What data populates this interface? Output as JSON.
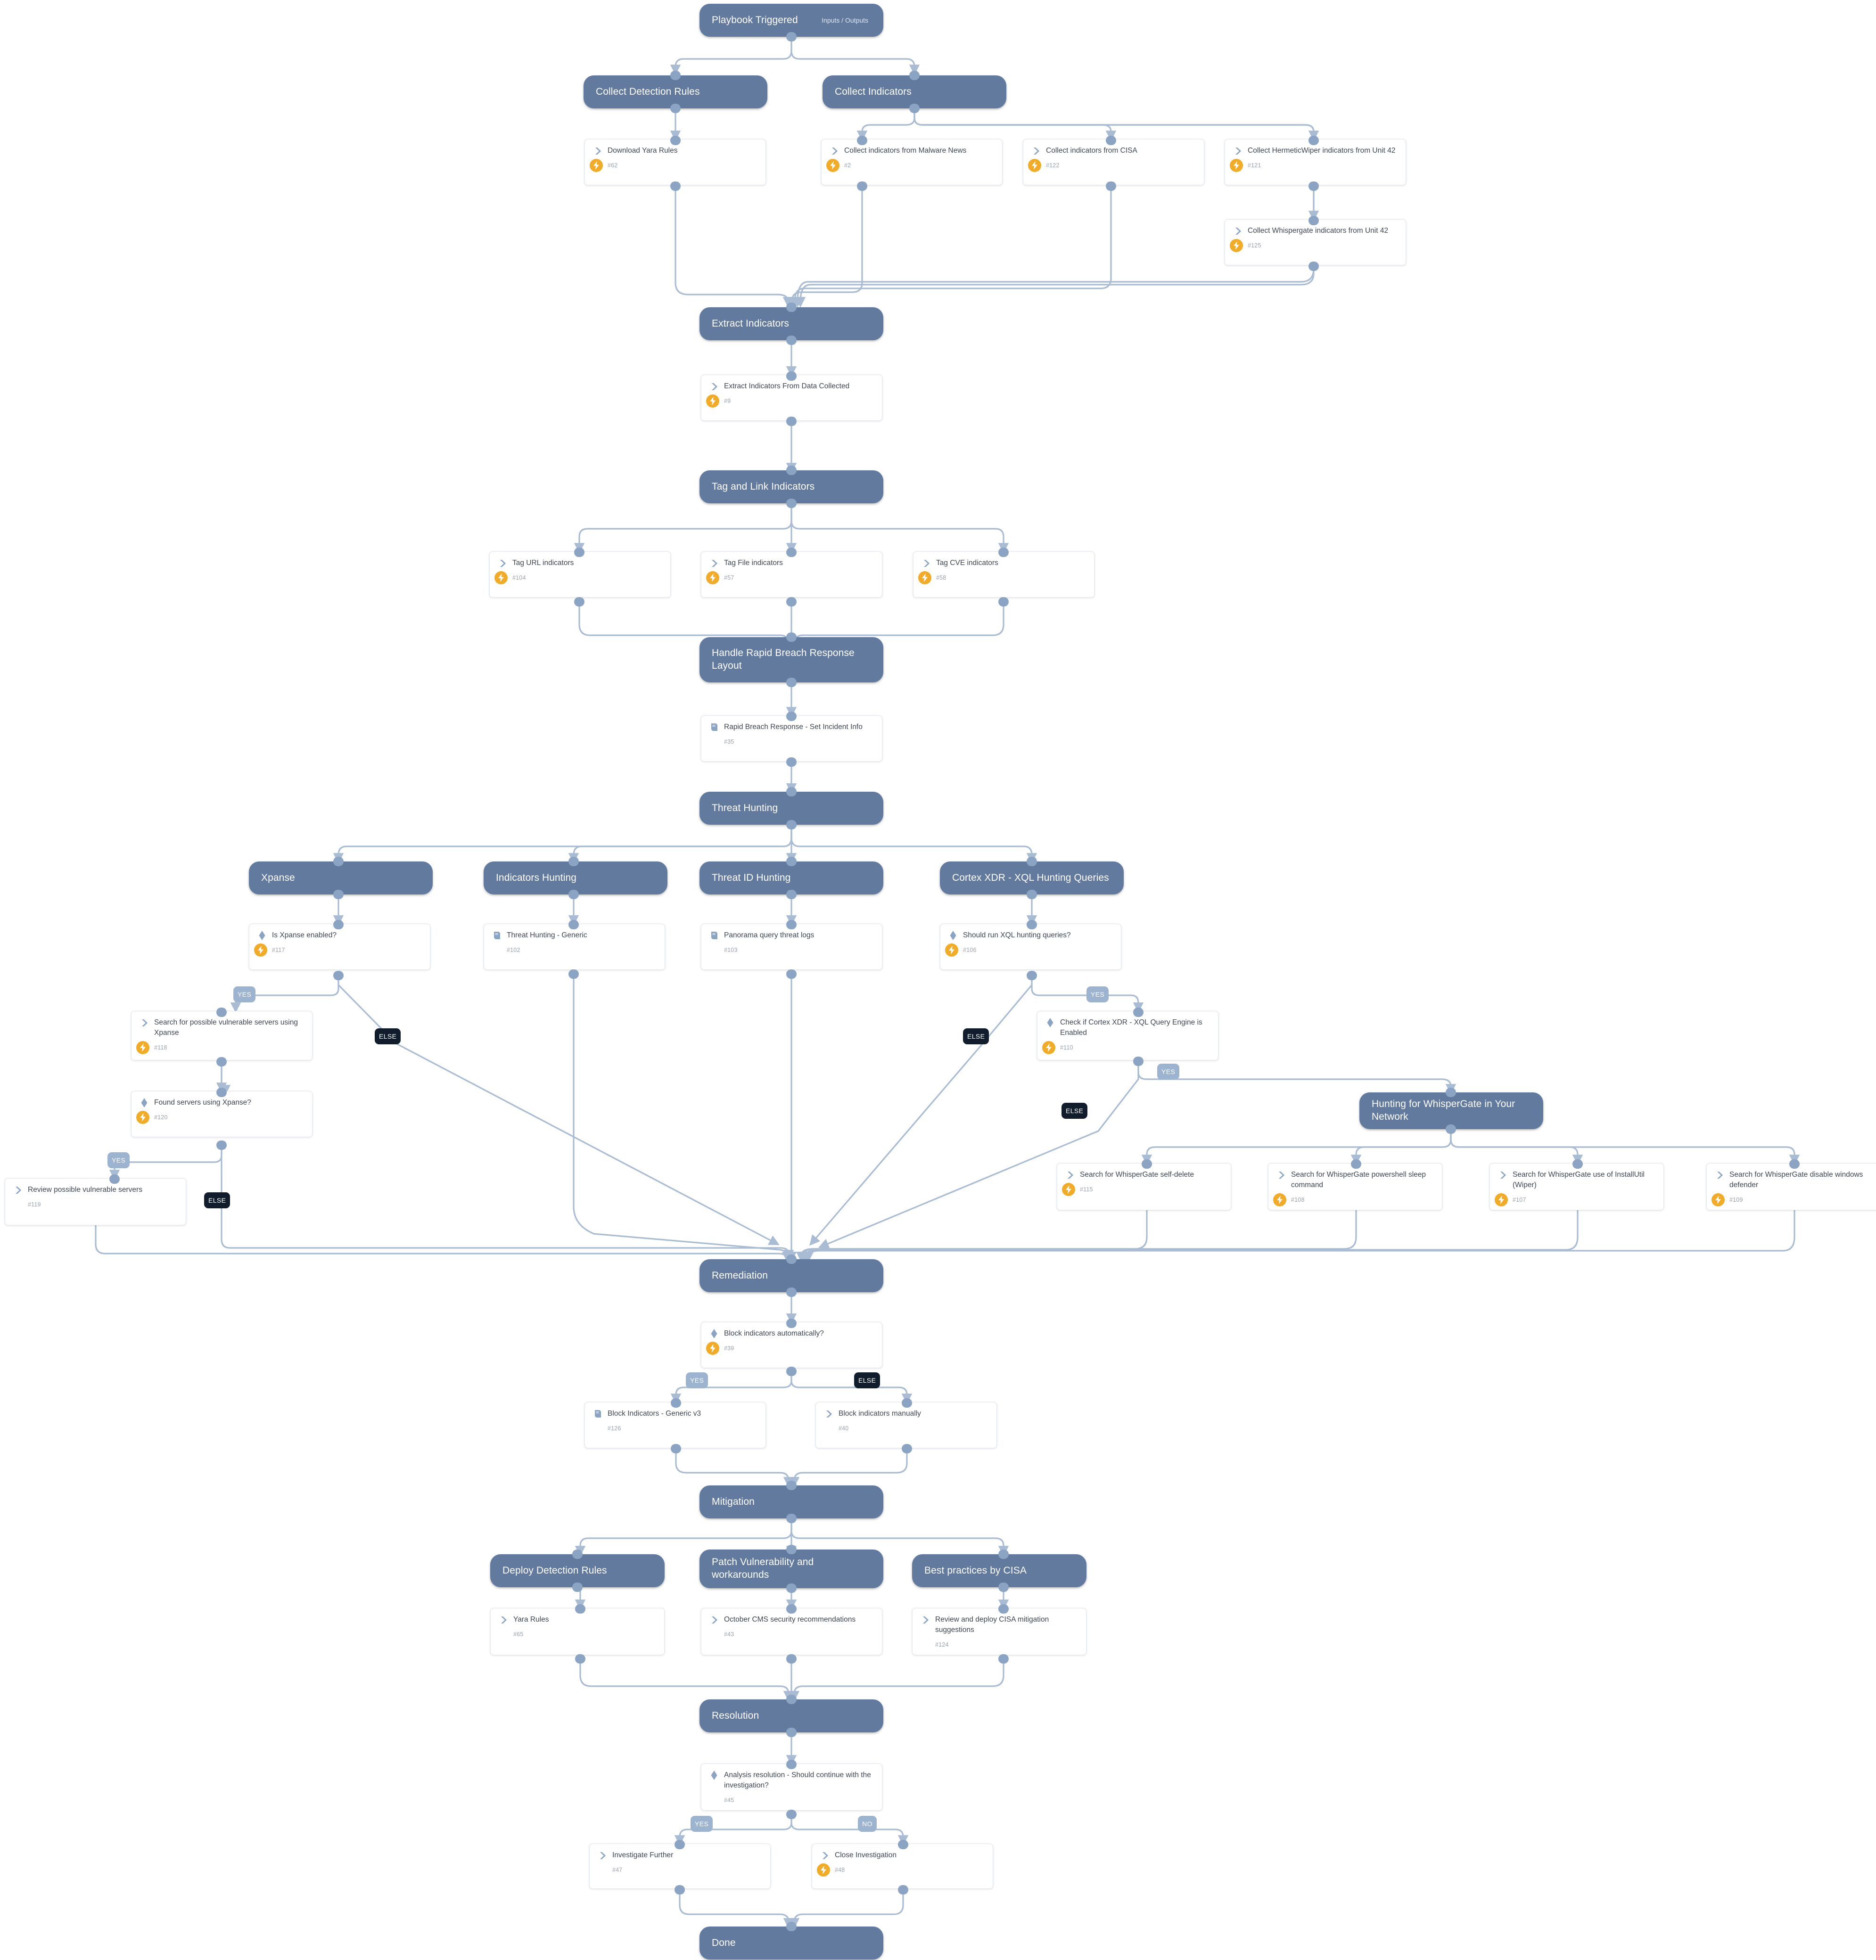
{
  "meta": {
    "diagram_title": "Playbook Triggered",
    "inputs_outputs_label": "Inputs / Outputs"
  },
  "colors": {
    "section_fill": "#637a9f",
    "card_border": "#e4e7ec",
    "badge_orange": "#f2ab27",
    "edge_blue": "#a9bcd4",
    "label_yes": "#9db4d0",
    "label_else": "#111c2d",
    "icon_blue": "#8ba4c4",
    "title_text": "#3f4651",
    "task_num_text": "#9aa1ac"
  },
  "sections": [
    {
      "id": "trigger",
      "title": "Playbook Triggered",
      "sub": "Inputs / Outputs"
    },
    {
      "id": "collect_rules",
      "title": "Collect Detection Rules",
      "sub": ""
    },
    {
      "id": "collect_ind",
      "title": "Collect Indicators",
      "sub": ""
    },
    {
      "id": "extract",
      "title": "Extract Indicators",
      "sub": ""
    },
    {
      "id": "taglink",
      "title": "Tag and Link Indicators",
      "sub": ""
    },
    {
      "id": "rbr",
      "title": "Handle Rapid Breach Response\nLayout",
      "sub": ""
    },
    {
      "id": "threat_hunting",
      "title": "Threat Hunting",
      "sub": ""
    },
    {
      "id": "xpanse",
      "title": "Xpanse",
      "sub": ""
    },
    {
      "id": "ind_hunting",
      "title": "Indicators Hunting",
      "sub": ""
    },
    {
      "id": "tid_hunting",
      "title": "Threat ID Hunting",
      "sub": ""
    },
    {
      "id": "xql",
      "title": "Cortex XDR - XQL Hunting Queries",
      "sub": ""
    },
    {
      "id": "hunt_wg",
      "title": "Hunting for WhisperGate in Your\nNetwork",
      "sub": ""
    },
    {
      "id": "remediation",
      "title": "Remediation",
      "sub": ""
    },
    {
      "id": "mitigation",
      "title": "Mitigation",
      "sub": ""
    },
    {
      "id": "deploy_rules",
      "title": "Deploy Detection Rules",
      "sub": ""
    },
    {
      "id": "patch_vuln",
      "title": "Patch Vulnerability and\nworkarounds",
      "sub": ""
    },
    {
      "id": "cisa_best",
      "title": "Best practices by CISA",
      "sub": ""
    },
    {
      "id": "resolution",
      "title": "Resolution",
      "sub": ""
    },
    {
      "id": "done",
      "title": "Done",
      "sub": ""
    }
  ],
  "tasks": [
    {
      "id": "t62",
      "title": "Download Yara Rules",
      "num": "#62",
      "icon": "chevron-icon",
      "automated": true
    },
    {
      "id": "t2",
      "title": "Collect indicators from Malware News",
      "num": "#2",
      "icon": "chevron-icon",
      "automated": true
    },
    {
      "id": "t122",
      "title": "Collect indicators from CISA",
      "num": "#122",
      "icon": "chevron-icon",
      "automated": true
    },
    {
      "id": "t121",
      "title": "Collect HermeticWiper indicators from Unit 42",
      "num": "#121",
      "icon": "chevron-icon",
      "automated": true
    },
    {
      "id": "t125",
      "title": "Collect Whispergate indicators from Unit 42",
      "num": "#125",
      "icon": "chevron-icon",
      "automated": true
    },
    {
      "id": "t9",
      "title": "Extract Indicators From Data Collected",
      "num": "#9",
      "icon": "chevron-icon",
      "automated": true
    },
    {
      "id": "t104",
      "title": "Tag URL indicators",
      "num": "#104",
      "icon": "chevron-icon",
      "automated": true
    },
    {
      "id": "t57",
      "title": "Tag File indicators",
      "num": "#57",
      "icon": "chevron-icon",
      "automated": true
    },
    {
      "id": "t58",
      "title": "Tag CVE indicators",
      "num": "#58",
      "icon": "chevron-icon",
      "automated": true
    },
    {
      "id": "t35",
      "title": "Rapid Breach Response - Set Incident Info",
      "num": "#35",
      "icon": "book-icon",
      "automated": false
    },
    {
      "id": "t117",
      "title": "Is Xpanse enabled?",
      "num": "#117",
      "icon": "diamond-icon",
      "automated": true
    },
    {
      "id": "t102",
      "title": "Threat Hunting - Generic",
      "num": "#102",
      "icon": "book-icon",
      "automated": false
    },
    {
      "id": "t103",
      "title": "Panorama query threat logs",
      "num": "#103",
      "icon": "book-icon",
      "automated": false
    },
    {
      "id": "t106",
      "title": "Should run XQL hunting queries?",
      "num": "#106",
      "icon": "diamond-icon",
      "automated": true
    },
    {
      "id": "t118",
      "title": "Search for possible vulnerable servers using Xpanse",
      "num": "#118",
      "icon": "chevron-icon",
      "automated": true
    },
    {
      "id": "t110",
      "title": "Check if Cortex XDR - XQL Query Engine is Enabled",
      "num": "#110",
      "icon": "diamond-icon",
      "automated": true
    },
    {
      "id": "t120",
      "title": "Found servers using Xpanse?",
      "num": "#120",
      "icon": "diamond-icon",
      "automated": true
    },
    {
      "id": "t119",
      "title": "Review possible vulnerable servers",
      "num": "#119",
      "icon": "chevron-icon",
      "automated": false
    },
    {
      "id": "t115",
      "title": "Search for WhisperGate self-delete",
      "num": "#115",
      "icon": "chevron-icon",
      "automated": true
    },
    {
      "id": "t108",
      "title": "Search for WhisperGate powershell sleep command",
      "num": "#108",
      "icon": "chevron-icon",
      "automated": true
    },
    {
      "id": "t107",
      "title": "Search for WhisperGate use of InstallUtil (Wiper)",
      "num": "#107",
      "icon": "chevron-icon",
      "automated": true
    },
    {
      "id": "t109",
      "title": "Search for WhisperGate disable windows defender",
      "num": "#109",
      "icon": "chevron-icon",
      "automated": true
    },
    {
      "id": "t39",
      "title": "Block indicators automatically?",
      "num": "#39",
      "icon": "diamond-icon",
      "automated": true
    },
    {
      "id": "t126",
      "title": "Block Indicators - Generic v3",
      "num": "#126",
      "icon": "book-icon",
      "automated": false
    },
    {
      "id": "t40",
      "title": "Block indicators manually",
      "num": "#40",
      "icon": "chevron-icon",
      "automated": false
    },
    {
      "id": "t65",
      "title": "Yara Rules",
      "num": "#65",
      "icon": "chevron-icon",
      "automated": false
    },
    {
      "id": "t43",
      "title": "October CMS security recommendations",
      "num": "#43",
      "icon": "chevron-icon",
      "automated": false
    },
    {
      "id": "t124",
      "title": "Review and deploy CISA mitigation suggestions",
      "num": "#124",
      "icon": "chevron-icon",
      "automated": false
    },
    {
      "id": "t45",
      "title": "Analysis resolution - Should continue with the investigation?",
      "num": "#45",
      "icon": "diamond-icon",
      "automated": false
    },
    {
      "id": "t47",
      "title": "Investigate Further",
      "num": "#47",
      "icon": "chevron-icon",
      "automated": false
    },
    {
      "id": "t48",
      "title": "Close Investigation",
      "num": "#48",
      "icon": "chevron-icon",
      "automated": true
    }
  ],
  "branch_labels": [
    {
      "id": "b1",
      "text": "YES"
    },
    {
      "id": "b2",
      "text": "ELSE"
    },
    {
      "id": "b3",
      "text": "YES"
    },
    {
      "id": "b4",
      "text": "ELSE"
    },
    {
      "id": "b5",
      "text": "YES"
    },
    {
      "id": "b6",
      "text": "ELSE"
    },
    {
      "id": "b7",
      "text": "YES"
    },
    {
      "id": "b8",
      "text": "ELSE"
    },
    {
      "id": "b9",
      "text": "YES"
    },
    {
      "id": "b10",
      "text": "ELSE"
    },
    {
      "id": "b11",
      "text": "YES"
    },
    {
      "id": "b12",
      "text": "NO"
    }
  ]
}
